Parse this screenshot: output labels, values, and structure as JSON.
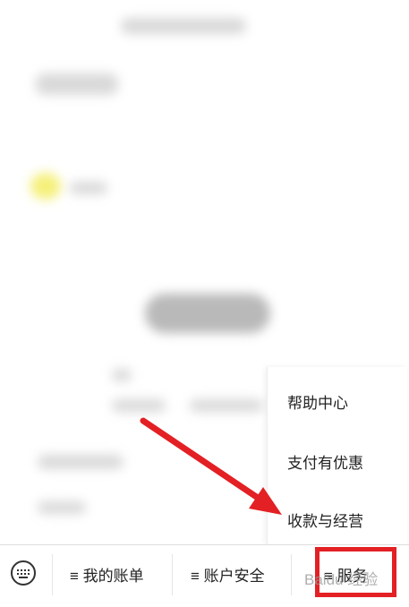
{
  "menu": {
    "items": [
      "帮助中心",
      "支付有优惠",
      "收款与经营"
    ]
  },
  "bottom_bar": {
    "keyboard_icon": "keyboard-icon",
    "tabs": [
      "≡ 我的账单",
      "≡ 账户安全",
      "≡ 服务"
    ]
  },
  "watermark": "Baidu 经验",
  "colors": {
    "highlight": "#e32024",
    "arrow": "#e32024"
  }
}
